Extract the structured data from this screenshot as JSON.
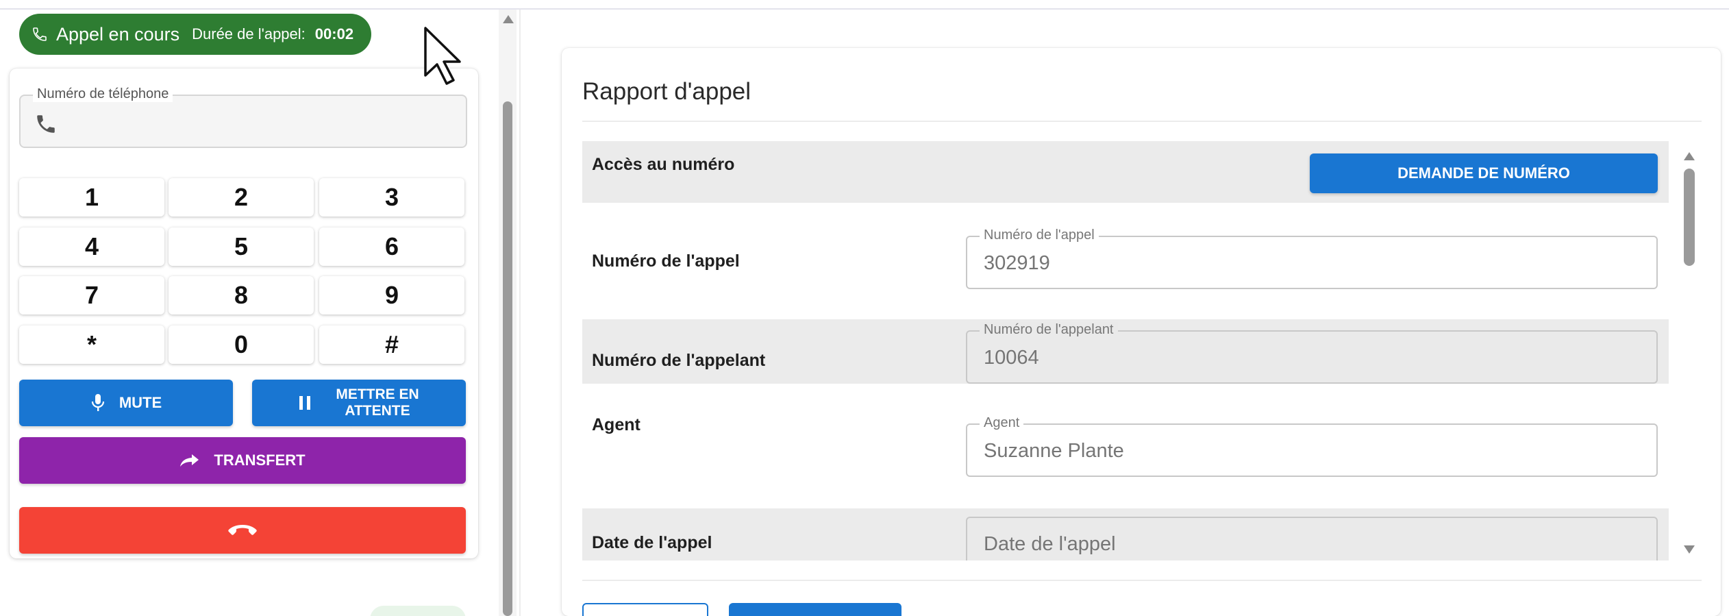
{
  "call_status": {
    "label": "Appel en cours",
    "duration_label": "Durée de l'appel:",
    "duration_value": "00:02",
    "icon": "phone-icon"
  },
  "dialer": {
    "phone_field_label": "Numéro de téléphone",
    "phone_field_value": "",
    "keys": [
      "1",
      "2",
      "3",
      "4",
      "5",
      "6",
      "7",
      "8",
      "9",
      "*",
      "0",
      "#"
    ],
    "mute_label": "MUTE",
    "hold_label_line1": "METTRE EN",
    "hold_label_line2": "ATTENTE",
    "transfer_label": "TRANSFERT",
    "colors": {
      "call_chip": "#2e7d32",
      "primary": "#1976d2",
      "transfer": "#8e24aa",
      "hangup": "#f44336"
    }
  },
  "report": {
    "title": "Rapport d'appel",
    "rows": [
      {
        "label": "Accès au numéro",
        "button_label": "DEMANDE DE NUMÉRO"
      },
      {
        "label": "Numéro de l'appel",
        "field_label": "Numéro de l'appel",
        "value": "302919"
      },
      {
        "label": "Numéro de l'appelant",
        "field_label": "Numéro de l'appelant",
        "value": "10064"
      },
      {
        "label": "Agent",
        "field_label": "Agent",
        "value": "Suzanne Plante"
      },
      {
        "label": "Date de l'appel",
        "placeholder": "Date de l'appel"
      }
    ]
  }
}
